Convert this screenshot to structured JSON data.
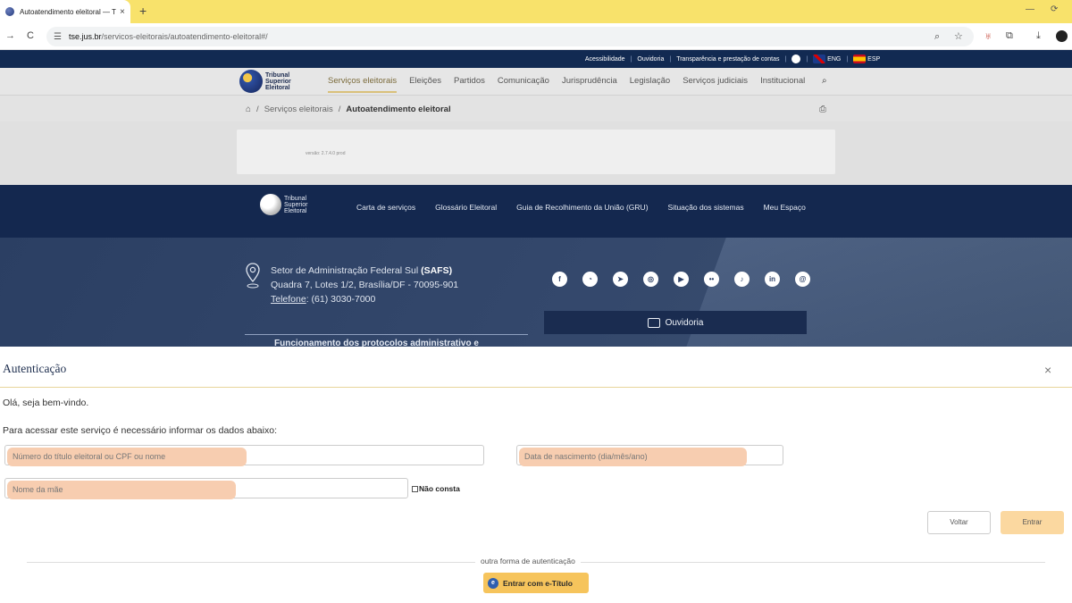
{
  "browser": {
    "tab_title": "Autoatendimento eleitoral — T",
    "tab_close": "×",
    "new_tab": "+",
    "url_host": "tse.jus.br",
    "url_path": "/servicos-eleitorais/autoatendimento-eleitoral#/",
    "icons": [
      "back-icon",
      "reload-icon",
      "site-settings-icon",
      "zoom-icon",
      "bookmark-star-icon",
      "extension-icon",
      "puzzle-icon",
      "download-icon",
      "profile-icon",
      "minimize-icon",
      "restore-icon"
    ]
  },
  "site_top": {
    "acessibilidade": "Acessibilidade",
    "ouvidoria": "Ouvidoria",
    "transparencia": "Transparência e prestação de contas",
    "eng": "ENG",
    "esp": "ESP"
  },
  "logo": {
    "line1": "Tribunal",
    "line2": "Superior",
    "line3": "Eleitoral"
  },
  "nav": {
    "items": [
      "Serviços eleitorais",
      "Eleições",
      "Partidos",
      "Comunicação",
      "Jurisprudência",
      "Legislação",
      "Serviços judiciais",
      "Institucional"
    ]
  },
  "breadcrumb": {
    "sep": "/",
    "item1": "Serviços eleitorais",
    "current": "Autoatendimento eleitoral"
  },
  "content": {
    "version": "versão: 2.7.4.0 prod"
  },
  "footer_nav": {
    "items": [
      "Carta de serviços",
      "Glossário Eleitoral",
      "Guia de Recolhimento da União (GRU)",
      "Situação dos sistemas",
      "Meu Espaço"
    ]
  },
  "footer": {
    "addr_line1_pre": "Setor de Administração Federal Sul ",
    "addr_line1_bold": "(SAFS)",
    "addr_line2": "Quadra 7, Lotes 1/2, Brasília/DF - 70095-901",
    "tel_label": "Telefone",
    "tel_value": ": (61) 3030-7000",
    "funcionamento": "Funcionamento dos protocolos administrativo e",
    "socials": [
      "facebook-icon",
      "whatsapp-icon",
      "telegram-icon",
      "instagram-icon",
      "youtube-icon",
      "flickr-icon",
      "tiktok-icon",
      "linkedin-icon",
      "threads-icon"
    ],
    "ouvidoria_btn": "Ouvidoria"
  },
  "modal": {
    "title": "Autenticação",
    "close": "×",
    "welcome": "Olá, seja bem-vindo.",
    "instructions": "Para acessar este serviço é necessário informar os dados abaixo:",
    "field_titulo_placeholder": "Número do título eleitoral ou CPF ou nome",
    "field_nascimento_placeholder": "Data de nascimento (dia/mês/ano)",
    "field_mae_placeholder": "Nome da mãe",
    "nao_consta": "Não consta",
    "btn_voltar": "Voltar",
    "btn_entrar": "Entrar",
    "alt_label": "outra forma de autenticação",
    "btn_etitulo": "Entrar com e-Título"
  }
}
